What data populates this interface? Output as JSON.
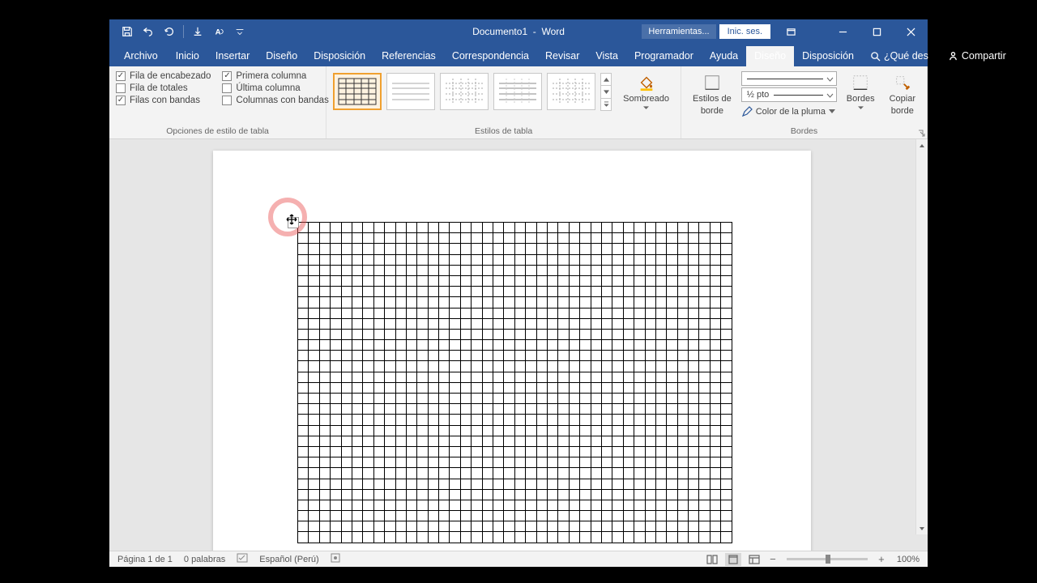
{
  "title": {
    "doc": "Documento1",
    "app": "Word",
    "tools": "Herramientas...",
    "signin": "Inic. ses."
  },
  "tabs": {
    "file": "Archivo",
    "home": "Inicio",
    "insert": "Insertar",
    "design": "Diseño",
    "layout": "Disposición",
    "references": "Referencias",
    "mailings": "Correspondencia",
    "review": "Revisar",
    "view": "Vista",
    "developer": "Programador",
    "help": "Ayuda",
    "table_design": "Diseño",
    "table_layout": "Disposición",
    "tellme": "¿Qué des",
    "share": "Compartir"
  },
  "opts": {
    "header_row": "Fila de encabezado",
    "total_row": "Fila de totales",
    "banded_rows": "Filas con bandas",
    "first_col": "Primera columna",
    "last_col": "Última columna",
    "banded_cols": "Columnas con bandas",
    "group": "Opciones de estilo de tabla",
    "checked": {
      "header_row": true,
      "total_row": false,
      "banded_rows": true,
      "first_col": true,
      "last_col": false,
      "banded_cols": false
    }
  },
  "styles": {
    "group": "Estilos de tabla",
    "shading": "Sombreado"
  },
  "borders": {
    "group": "Bordes",
    "border_styles": "Estilos de",
    "border_styles2": "borde",
    "weight": "½ pto",
    "pen_color": "Color de la pluma",
    "borders_btn": "Bordes",
    "painter": "Copiar",
    "painter2": "borde"
  },
  "status": {
    "page": "Página 1 de 1",
    "words": "0 palabras",
    "lang": "Español (Perú)",
    "zoom": "100%"
  }
}
